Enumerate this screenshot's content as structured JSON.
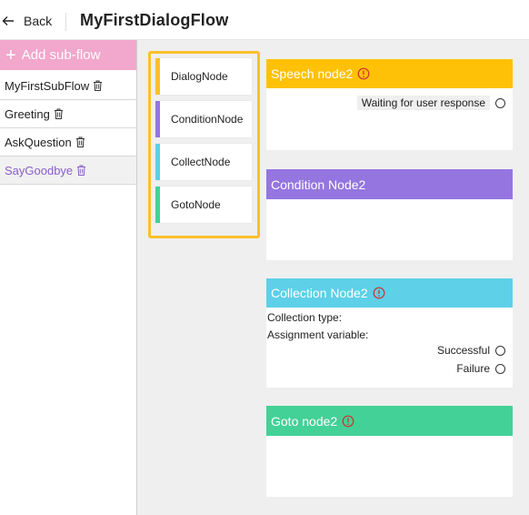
{
  "header": {
    "back_label": "Back",
    "title": "MyFirstDialogFlow"
  },
  "sidebar": {
    "add_label": "Add sub-flow",
    "add_color": "#f2a7cc",
    "items": [
      {
        "label": "MyFirstSubFlow",
        "active": false
      },
      {
        "label": "Greeting",
        "active": false
      },
      {
        "label": "AskQuestion",
        "active": false
      },
      {
        "label": "SayGoodbye",
        "active": true
      }
    ]
  },
  "palette": {
    "border_color": "#fbc02d",
    "items": [
      {
        "label": "DialogNode",
        "color": "#fbc02d"
      },
      {
        "label": "ConditionNode",
        "color": "#9575e0"
      },
      {
        "label": "CollectNode",
        "color": "#5ed0e8"
      },
      {
        "label": "GotoNode",
        "color": "#43d197"
      }
    ]
  },
  "nodes": {
    "speech": {
      "title": "Speech node2",
      "color": "#ffc107",
      "waiting_label": "Waiting for user response"
    },
    "condition": {
      "title": "Condition Node2",
      "color": "#9575e0"
    },
    "collection": {
      "title": "Collection Node2",
      "color": "#5ed0e8",
      "type_label": "Collection type:",
      "variable_label": "Assignment variable:",
      "success_label": "Successful",
      "failure_label": "Failure"
    },
    "goto": {
      "title": "Goto node2",
      "color": "#43d197"
    }
  },
  "icons": {
    "back": "arrow-left-icon",
    "add": "plus-icon",
    "delete": "trash-icon",
    "warning": "warning-circle-icon"
  }
}
